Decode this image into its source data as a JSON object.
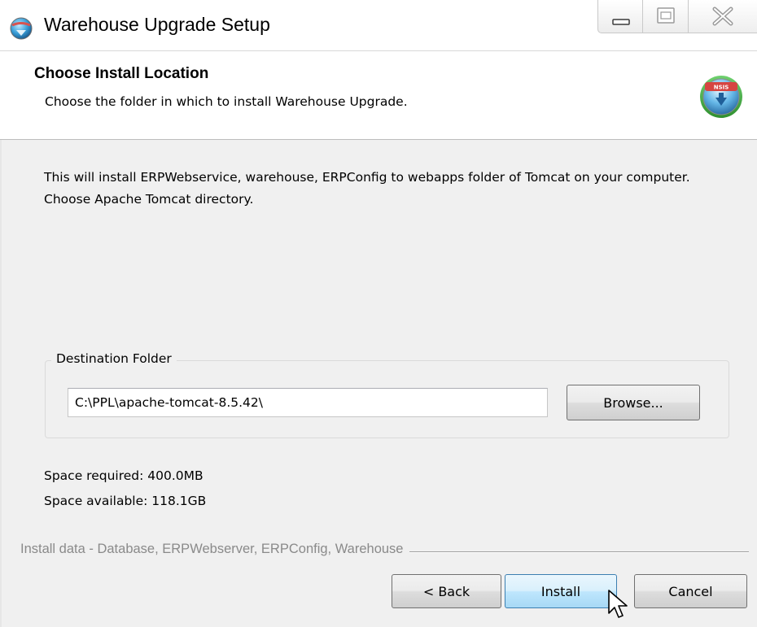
{
  "window": {
    "title": "Warehouse Upgrade Setup"
  },
  "header": {
    "title": "Choose Install Location",
    "subtitle": "Choose the folder in which to install Warehouse Upgrade.",
    "icon_badge": "NSIS"
  },
  "body": {
    "description": "This will install ERPWebservice, warehouse, ERPConfig to webapps folder of Tomcat on your computer. Choose Apache Tomcat directory.",
    "destination": {
      "group_label": "Destination Folder",
      "path_value": "C:\\PPL\\apache-tomcat-8.5.42\\",
      "browse_label": "Browse..."
    },
    "space_required": "Space required: 400.0MB",
    "space_available": "Space available: 118.1GB"
  },
  "footer": {
    "branding_text": "Install data - Database, ERPWebserver, ERPConfig, Warehouse",
    "back_label": "< Back",
    "install_label": "Install",
    "cancel_label": "Cancel"
  },
  "colors": {
    "dialog_bg": "#f0f0f0",
    "header_bg": "#ffffff",
    "default_button_border": "#3c7fb1",
    "branding_text": "#8a8a8a"
  },
  "icons": {
    "app": "installer-globe-icon",
    "header": "nsis-installer-icon",
    "minimize": "minimize-icon",
    "maximize": "maximize-icon",
    "close": "close-icon",
    "cursor": "mouse-pointer-icon"
  }
}
